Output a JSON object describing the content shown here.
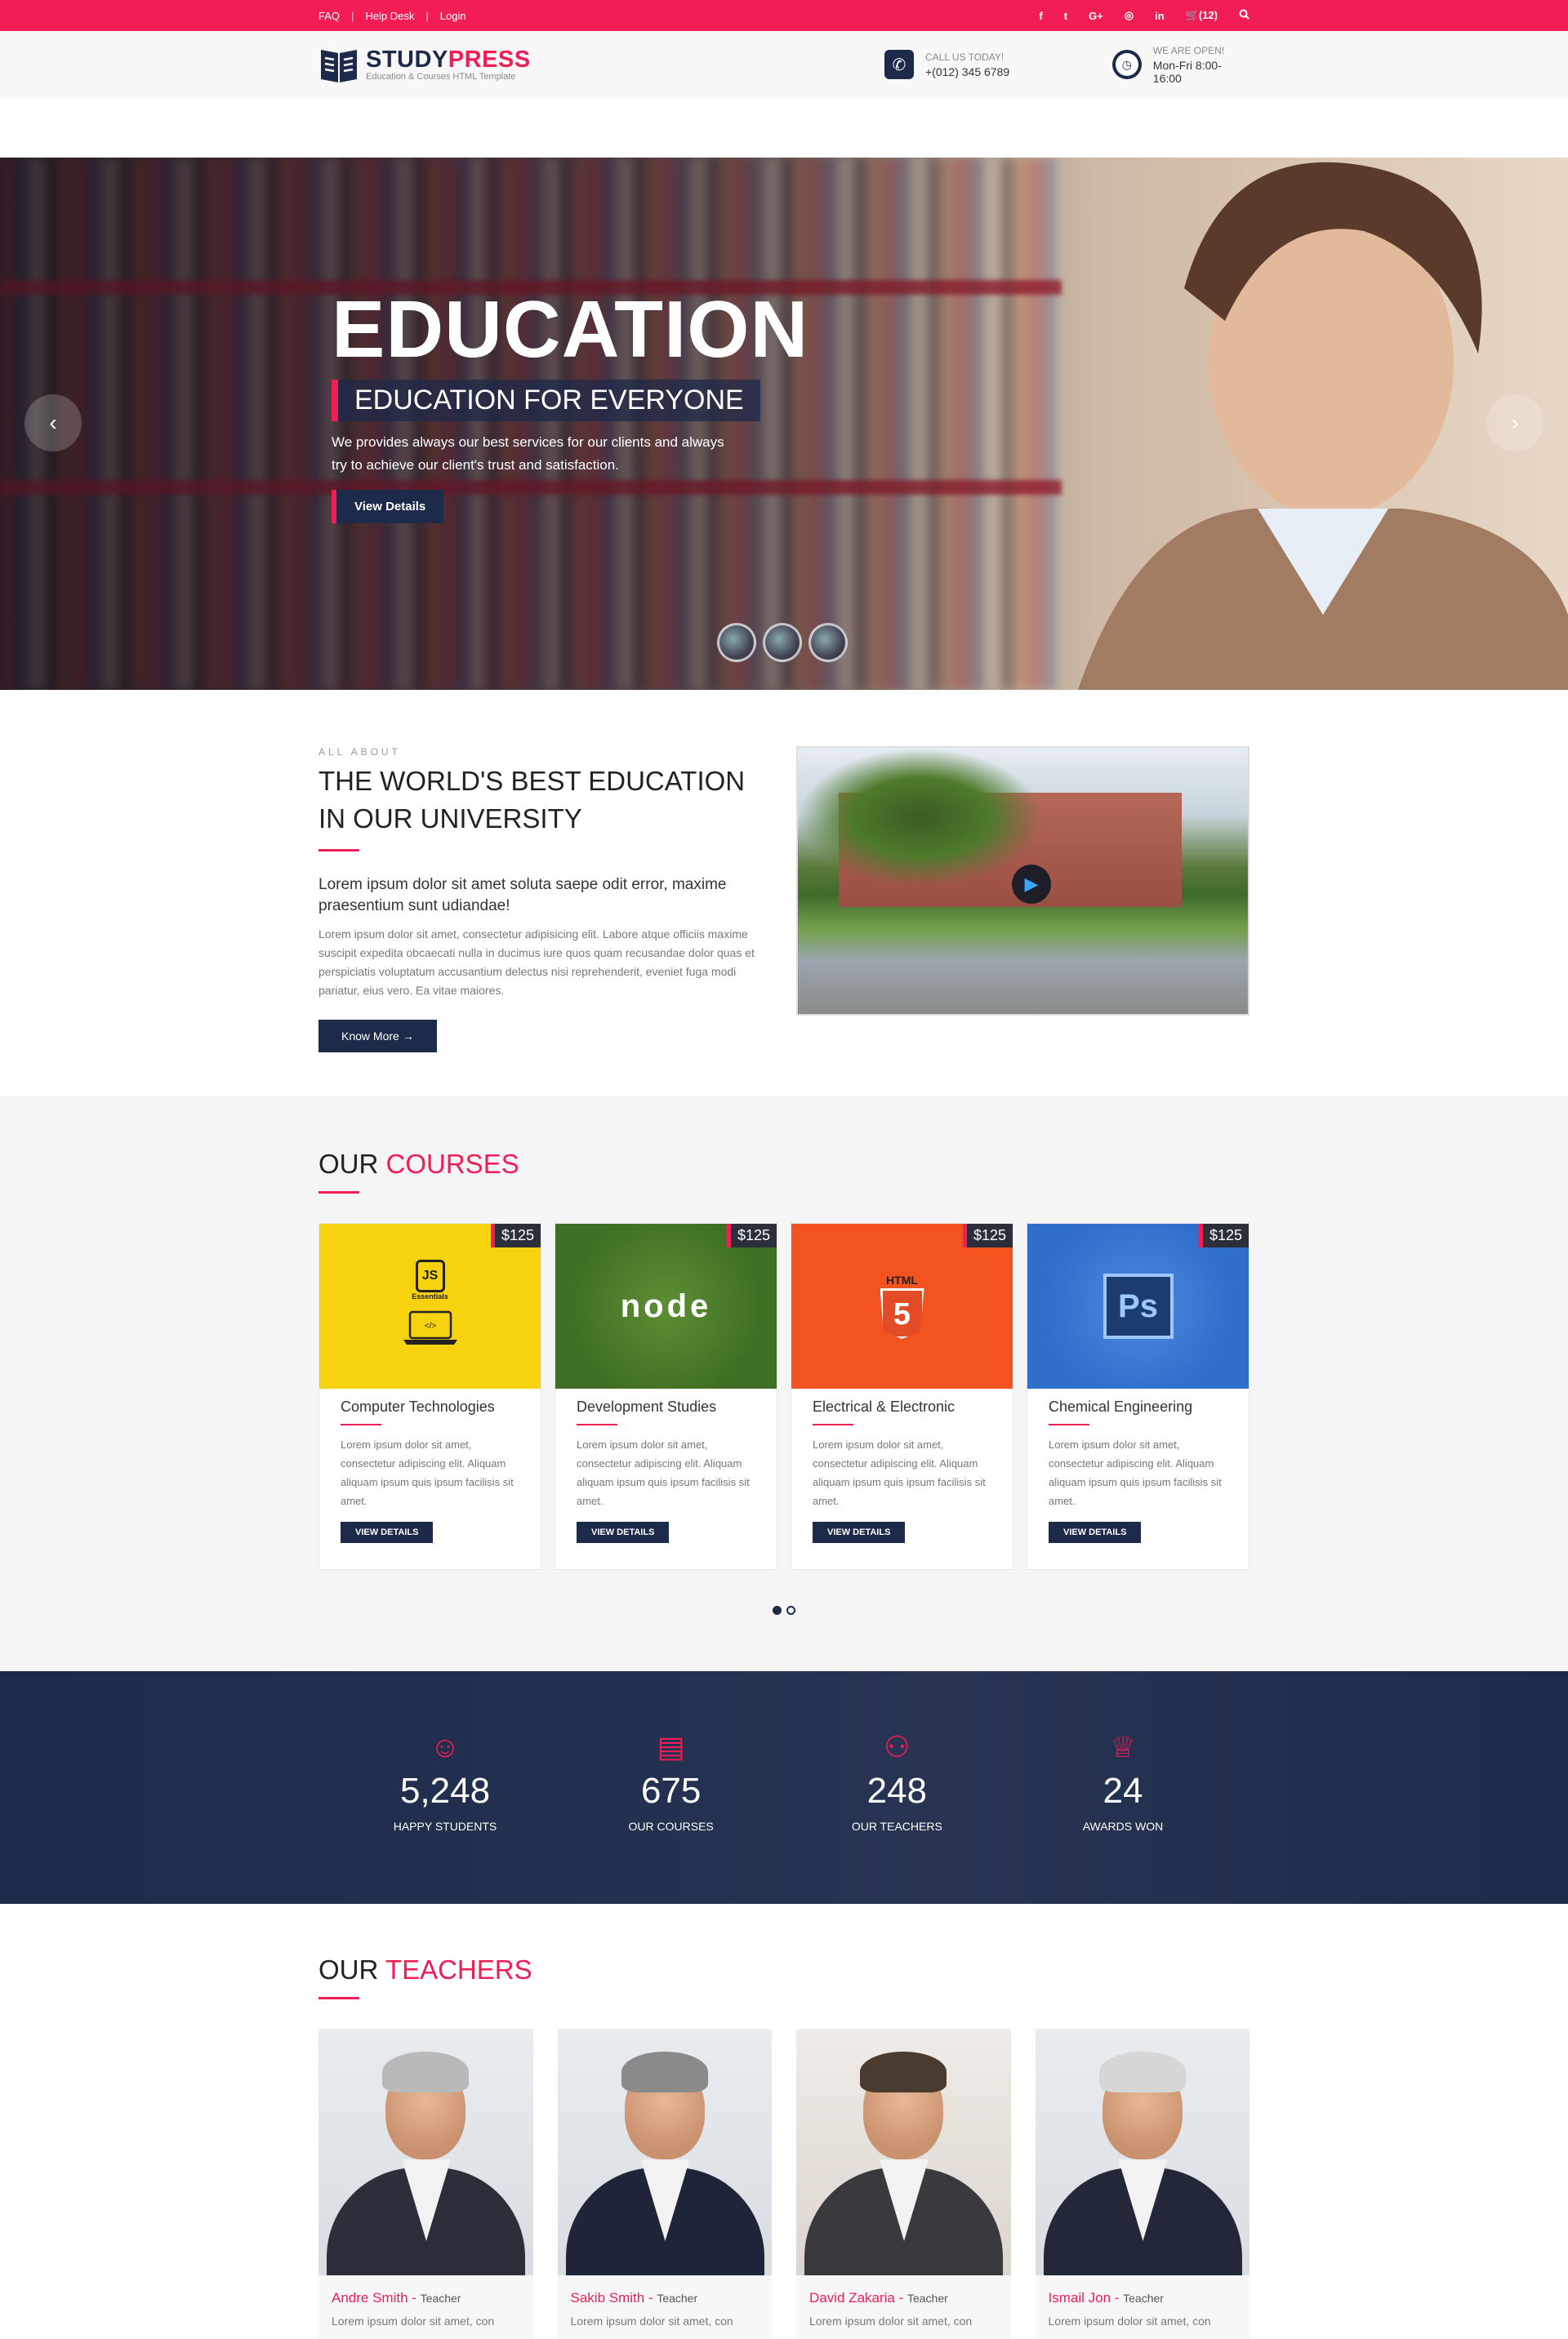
{
  "topbar": {
    "links": [
      "FAQ",
      "Help Desk",
      "Login"
    ],
    "social_icons": [
      "facebook-icon",
      "twitter-icon",
      "google-plus-icon",
      "instagram-icon",
      "linkedin-icon"
    ],
    "cart_count": "(12)",
    "social_glyphs": [
      "f",
      "t",
      "G+",
      "◎",
      "in"
    ]
  },
  "header": {
    "brand_part1": "STUDY",
    "brand_part2": "PRESS",
    "tagline": "Education & Courses HTML Template",
    "call_label": "CALL US TODAY!",
    "call_value": "+(012) 345 6789",
    "open_label": "WE ARE OPEN!",
    "open_value": "Mon-Fri 8:00-16:00"
  },
  "hero": {
    "title": "EDUCATION",
    "subtitle": "EDUCATION FOR EVERYONE",
    "description": "We provides always our best services for our clients and always try to achieve our client's trust and satisfaction.",
    "button": "View Details",
    "prev": "‹",
    "next": "›"
  },
  "about": {
    "eyebrow": "ALL ABOUT",
    "title": "THE WORLD'S BEST EDUCATION IN OUR UNIVERSITY",
    "lead": "Lorem ipsum dolor sit amet soluta saepe odit error, maxime praesentium sunt udiandae!",
    "body": "Lorem ipsum dolor sit amet, consectetur adipisicing elit. Labore atque officiis maxime suscipit expedita obcaecati nulla in ducimus iure quos quam recusandae dolor quas et perspiciatis voluptatum accusantium delectus nisi reprehenderit, eveniet fuga modi pariatur, eius vero. Ea vitae maiores.",
    "button": "Know More →"
  },
  "courses": {
    "title_plain": "OUR",
    "title_accent": "COURSES",
    "items": [
      {
        "title": "Computer Technologies",
        "price": "$125",
        "desc": "Lorem ipsum dolor sit amet, consectetur adipiscing elit. Aliquam aliquam ipsum quis ipsum facilisis sit amet.",
        "button": "VIEW DETAILS",
        "badge": "JS",
        "badge_sub": "Essentials"
      },
      {
        "title": "Development Studies",
        "price": "$125",
        "desc": "Lorem ipsum dolor sit amet, consectetur adipiscing elit. Aliquam aliquam ipsum quis ipsum facilisis sit amet.",
        "button": "VIEW DETAILS",
        "badge": "node"
      },
      {
        "title": "Electrical & Electronic",
        "price": "$125",
        "desc": "Lorem ipsum dolor sit amet, consectetur adipiscing elit. Aliquam aliquam ipsum quis ipsum facilisis sit amet.",
        "button": "VIEW DETAILS",
        "badge": "HTML",
        "badge_sub": "5"
      },
      {
        "title": "Chemical Engineering",
        "price": "$125",
        "desc": "Lorem ipsum dolor sit amet, consectetur adipiscing elit. Aliquam aliquam ipsum quis ipsum facilisis sit amet.",
        "button": "VIEW DETAILS",
        "badge": "Ps"
      }
    ],
    "colors": {
      "yellow": "#f7d20e",
      "green": "#3f6f24",
      "orange": "#f2531f",
      "blue": "#2f6ec9"
    }
  },
  "stats": [
    {
      "icon": "smiley-icon",
      "glyph": "☺",
      "value": "5,248",
      "label": "HAPPY STUDENTS"
    },
    {
      "icon": "clipboard-icon",
      "glyph": "▤",
      "value": "675",
      "label": "OUR COURSES"
    },
    {
      "icon": "users-icon",
      "glyph": "⚇",
      "value": "248",
      "label": "OUR TEACHERS"
    },
    {
      "icon": "trophy-icon",
      "glyph": "♕",
      "value": "24",
      "label": "AWARDS WON"
    }
  ],
  "teachers": {
    "title_plain": "OUR",
    "title_accent": "TEACHERS",
    "items": [
      {
        "name": "Andre Smith",
        "role": "Teacher",
        "desc": "Lorem ipsum dolor sit amet, con"
      },
      {
        "name": "Sakib Smith",
        "role": "Teacher",
        "desc": "Lorem ipsum dolor sit amet, con"
      },
      {
        "name": "David Zakaria",
        "role": "Teacher",
        "desc": "Lorem ipsum dolor sit amet, con"
      },
      {
        "name": "Ismail Jon",
        "role": "Teacher",
        "desc": "Lorem ipsum dolor sit amet, con"
      }
    ]
  },
  "theme": {
    "accent": "#f21d55",
    "navy": "#1e2a4a"
  }
}
